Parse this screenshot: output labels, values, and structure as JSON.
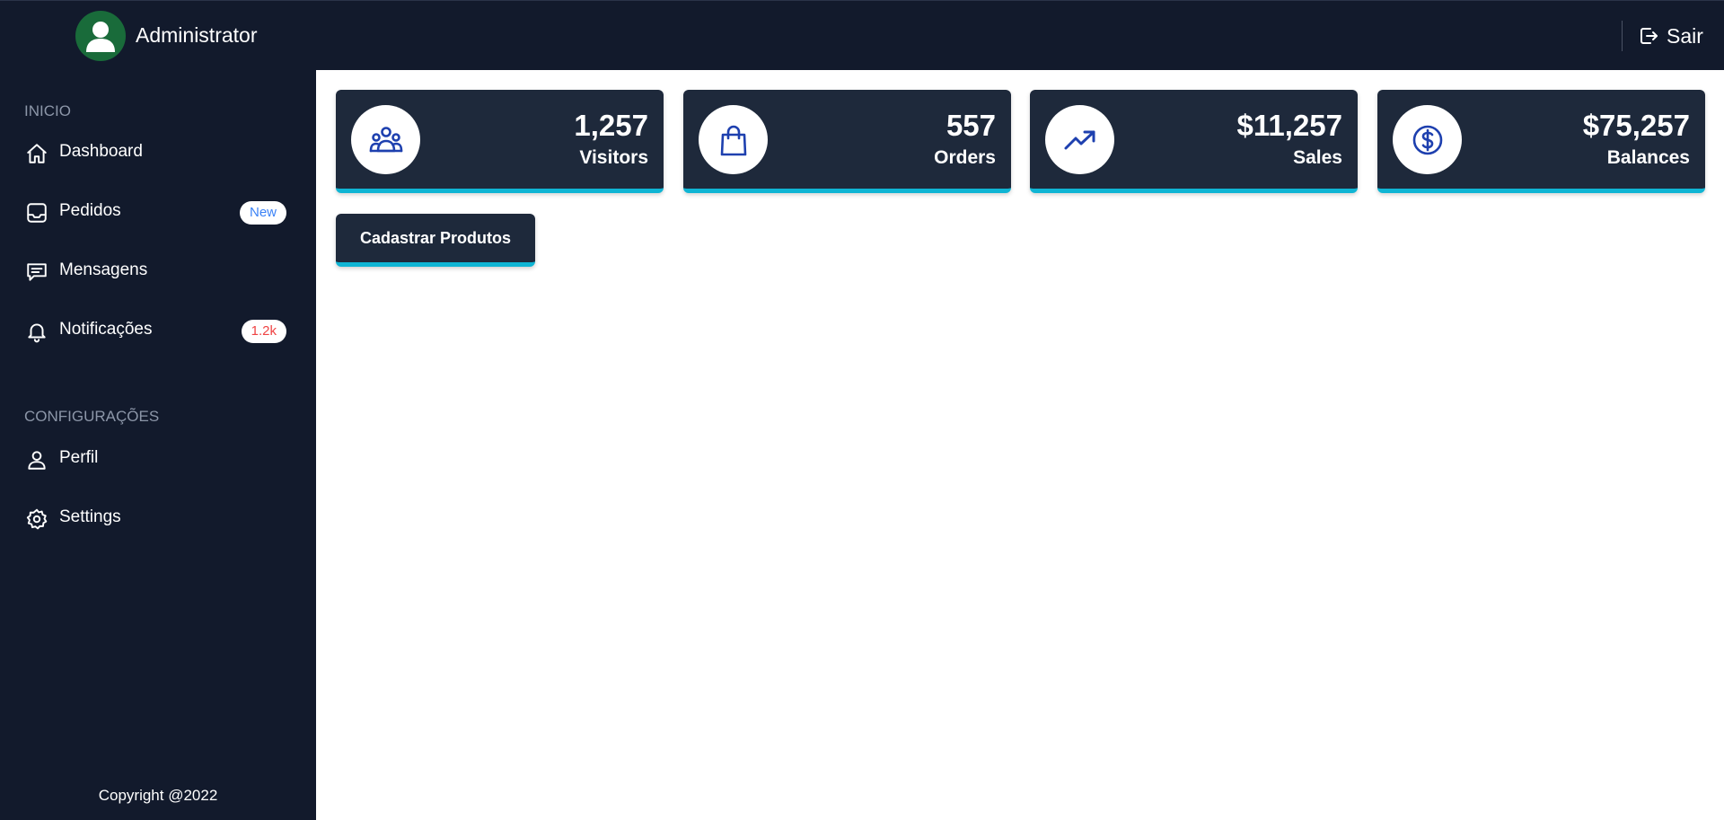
{
  "header": {
    "user_name": "Administrator",
    "logout_label": "Sair"
  },
  "sidebar": {
    "sections": [
      {
        "title": "INICIO",
        "items": [
          {
            "label": "Dashboard",
            "icon": "home-icon"
          },
          {
            "label": "Pedidos",
            "icon": "inbox-icon",
            "badge": "New",
            "badge_color": "#3b82f6"
          },
          {
            "label": "Mensagens",
            "icon": "message-icon"
          },
          {
            "label": "Notificações",
            "icon": "bell-icon",
            "badge": "1.2k",
            "badge_color": "#ef4444"
          }
        ]
      },
      {
        "title": "CONFIGURAÇÕES",
        "items": [
          {
            "label": "Perfil",
            "icon": "user-icon"
          },
          {
            "label": "Settings",
            "icon": "gear-icon"
          }
        ]
      }
    ],
    "copyright": "Copyright @2022"
  },
  "stats": [
    {
      "value": "1,257",
      "label": "Visitors",
      "icon": "users-icon"
    },
    {
      "value": "557",
      "label": "Orders",
      "icon": "shopping-bag-icon"
    },
    {
      "value": "$11,257",
      "label": "Sales",
      "icon": "trending-up-icon"
    },
    {
      "value": "$75,257",
      "label": "Balances",
      "icon": "dollar-circle-icon"
    }
  ],
  "actions": {
    "register_products_label": "Cadastrar Produtos"
  },
  "colors": {
    "sidebar_bg": "#121a2c",
    "card_bg": "#1e293b",
    "accent": "#0fb5d4",
    "icon_blue": "#1e40af",
    "avatar_bg": "#196b3a"
  }
}
